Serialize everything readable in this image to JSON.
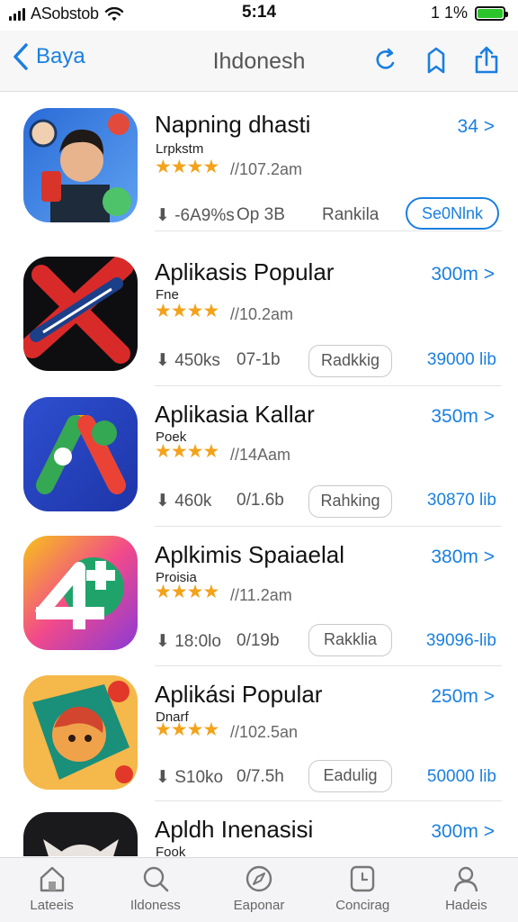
{
  "status": {
    "carrier": "ASobstob",
    "time": "5:14",
    "battery": "1 1%"
  },
  "nav": {
    "back_label": "Baya",
    "title": "Ihdonesh"
  },
  "apps": [
    {
      "name": "Napning dhasti",
      "category": "Lrpkstm",
      "stars": "★★★★",
      "rating": "//107.2am",
      "price": "34 >",
      "downloads": "-6A9%s",
      "size": "Op 3B",
      "rank_label": "Rankila",
      "button": "Se0Nlnk"
    },
    {
      "name": "Aplikasis Popular",
      "category": "Fne",
      "stars": "★★★★",
      "rating": "//10.2am",
      "price": "300m >",
      "downloads": "450ks",
      "size": "07-1b",
      "rank_label": "Radkkig",
      "count": "39000 lib"
    },
    {
      "name": "Aplikasia Kallar",
      "category": "Poek",
      "stars": "★★★★",
      "rating": "//14Aam",
      "price": "350m >",
      "downloads": "460k",
      "size": "0/1.6b",
      "rank_label": "Rahking",
      "count": "30870 lib"
    },
    {
      "name": "Aplkimis Spaiaelal",
      "category": "Proisia",
      "stars": "★★★★",
      "rating": "//11.2am",
      "price": "380m >",
      "downloads": "18:0lo",
      "size": "0/19b",
      "rank_label": "Rakklia",
      "count": "39096-lib"
    },
    {
      "name": "Aplikási Popular",
      "category": "Dnarf",
      "stars": "★★★★",
      "rating": "//102.5an",
      "price": "250m >",
      "downloads": "S10ko",
      "size": "0/7.5h",
      "rank_label": "Eadulig",
      "count": "50000 lib"
    },
    {
      "name": "Apldh Inenasisi",
      "category": "Fook",
      "price": "300m >"
    }
  ],
  "tabs": [
    {
      "label": "Lateeis",
      "icon": "home-icon"
    },
    {
      "label": "Ildoness",
      "icon": "search-icon"
    },
    {
      "label": "Eaponar",
      "icon": "compass-icon"
    },
    {
      "label": "Concirag",
      "icon": "clock-icon"
    },
    {
      "label": "Hadeis",
      "icon": "person-icon"
    }
  ],
  "colors": {
    "accent": "#1a7fe0",
    "star": "#f3a21a",
    "battery": "#2bc42b"
  }
}
